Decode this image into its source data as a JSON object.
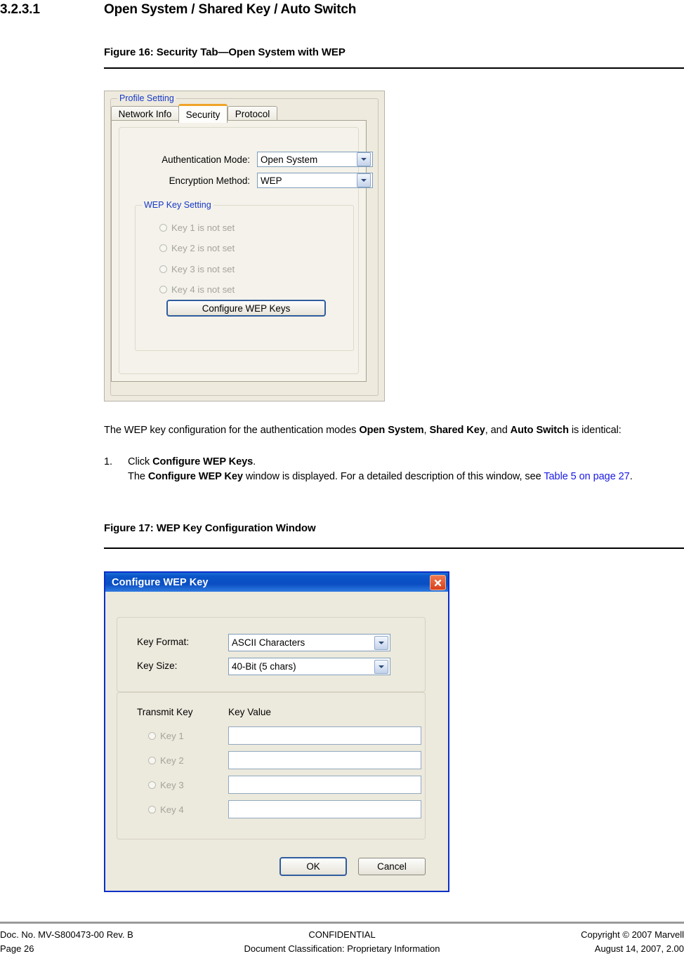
{
  "document": {
    "section_number": "3.2.3.1",
    "section_title": "Open System / Shared Key / Auto Switch",
    "figure16_caption": "Figure 16: Security Tab—Open System with WEP",
    "figure17_caption": "Figure 17: WEP Key Configuration Window",
    "paragraph": {
      "t1": "The WEP key configuration for the authentication modes ",
      "b1": "Open System",
      "t2": ", ",
      "b2": "Shared Key",
      "t3": ", and ",
      "b3": "Auto Switch",
      "t4": " is identical:"
    },
    "step1": {
      "marker": "1.",
      "l1a": "Click ",
      "l1b": "Configure WEP Keys",
      "l1c": ".",
      "l2a": "The ",
      "l2b": "Configure WEP Key",
      "l2c": " window is displayed. For a detailed description of this window, see ",
      "link": "Table 5 on page 27",
      "l2d": "."
    }
  },
  "security_tab_window": {
    "group_title": "Profile Setting",
    "tabs": [
      {
        "label": "Network Info",
        "active": false
      },
      {
        "label": "Security",
        "active": true
      },
      {
        "label": "Protocol",
        "active": false
      }
    ],
    "auth_mode_label": "Authentication Mode:",
    "auth_mode_value": "Open System",
    "encryption_label": "Encryption Method:",
    "encryption_value": "WEP",
    "wep_group_title": "WEP Key Setting",
    "wep_keys": [
      "Key 1 is not set",
      "Key 2 is not set",
      "Key 3 is not set",
      "Key 4 is not set"
    ],
    "configure_button": "Configure WEP Keys"
  },
  "wep_key_window": {
    "title": "Configure WEP Key",
    "close_icon": "close-icon",
    "key_format_label": "Key Format:",
    "key_format_value": "ASCII Characters",
    "key_size_label": "Key Size:",
    "key_size_value": "40-Bit (5 chars)",
    "transmit_key_header": "Transmit Key",
    "key_value_header": "Key Value",
    "keys": [
      {
        "label": "Key 1",
        "value": ""
      },
      {
        "label": "Key 2",
        "value": ""
      },
      {
        "label": "Key 3",
        "value": ""
      },
      {
        "label": "Key 4",
        "value": ""
      }
    ],
    "ok_button": "OK",
    "cancel_button": "Cancel"
  },
  "footer": {
    "doc_no": "Doc. No. MV-S800473-00 Rev. B",
    "confidential": "CONFIDENTIAL",
    "copyright": "Copyright © 2007 Marvell",
    "page": "Page 26",
    "classification": "Document Classification: Proprietary Information",
    "date": "August 14, 2007, 2.00"
  },
  "colors": {
    "link": "#1a1ae6",
    "group_legend": "#1638c8",
    "active_tab_accent": "#f0a428",
    "titlebar": "#0a55c8",
    "close_button": "#d8401b"
  }
}
